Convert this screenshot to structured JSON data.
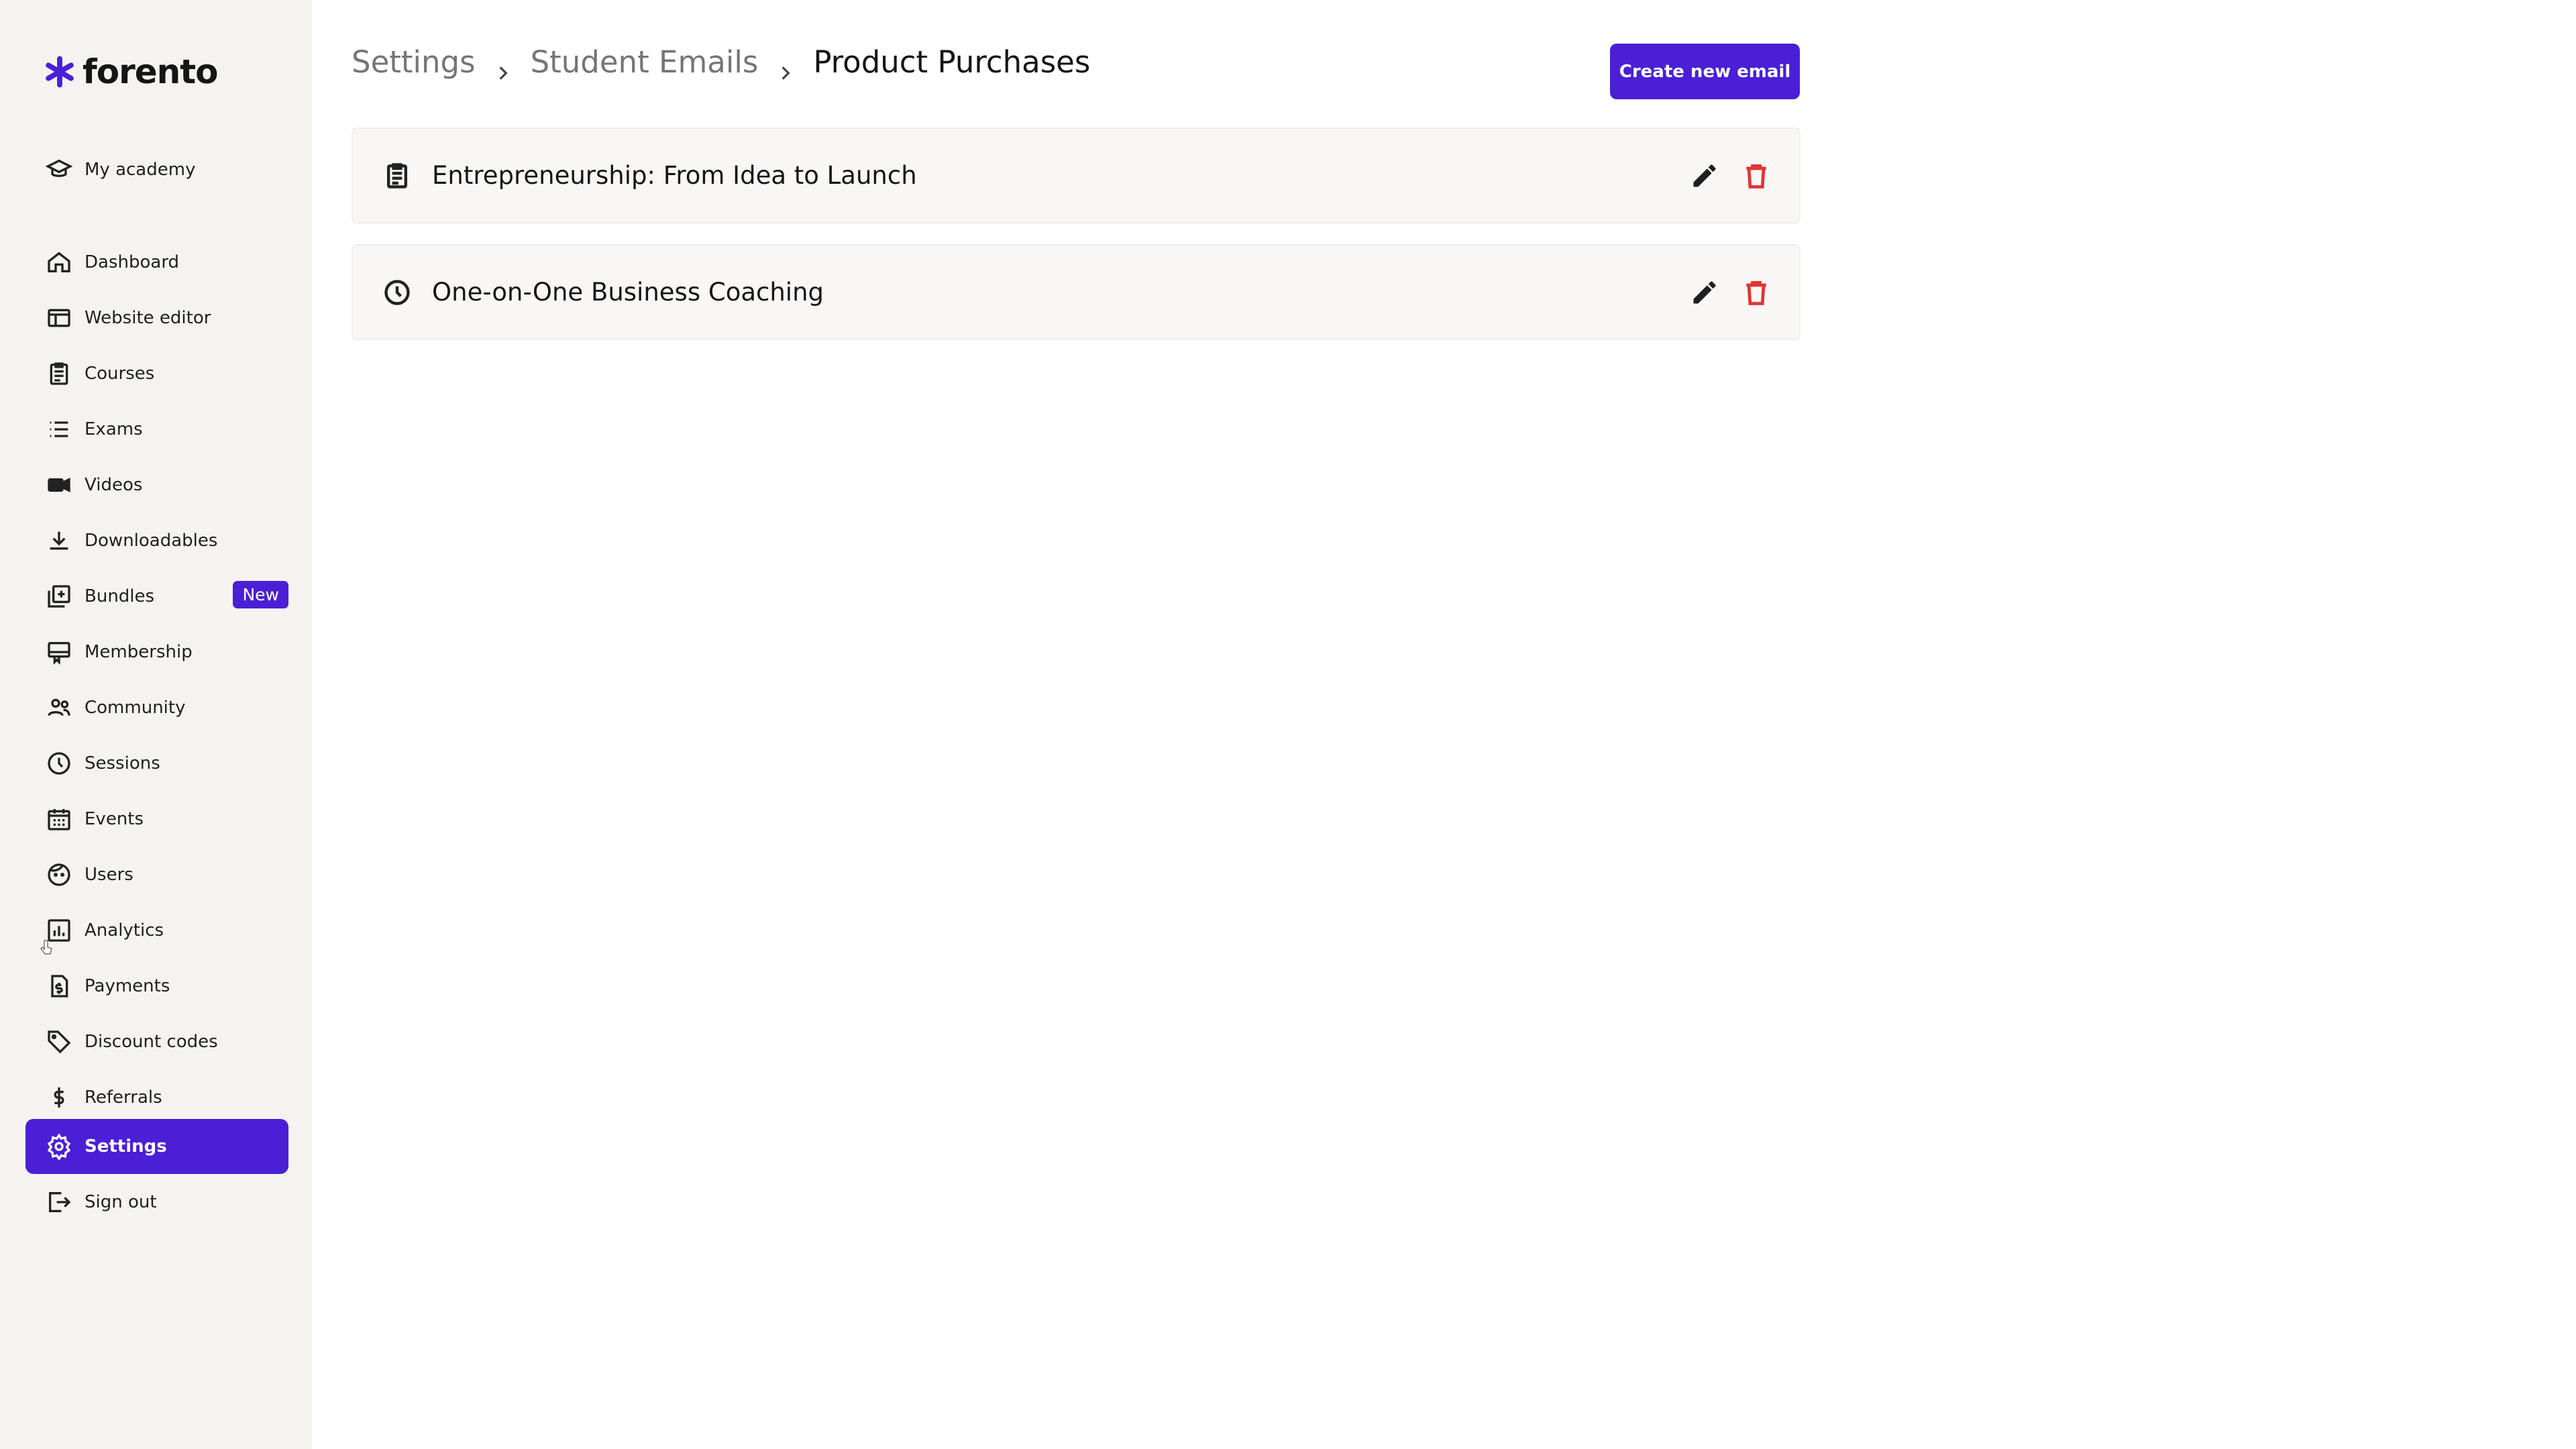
{
  "app": {
    "logo_text": "forento",
    "brand_color": "#4a1fd6"
  },
  "sidebar": {
    "top_item": {
      "label": "My academy",
      "icon": "academy-cap-icon"
    },
    "items": [
      {
        "label": "Dashboard",
        "icon": "home-icon"
      },
      {
        "label": "Website editor",
        "icon": "browser-window-icon"
      },
      {
        "label": "Courses",
        "icon": "clipboard-icon"
      },
      {
        "label": "Exams",
        "icon": "list-icon"
      },
      {
        "label": "Videos",
        "icon": "video-camera-icon"
      },
      {
        "label": "Downloadables",
        "icon": "download-icon"
      },
      {
        "label": "Bundles",
        "icon": "bundle-add-icon",
        "badge": "New"
      },
      {
        "label": "Membership",
        "icon": "membership-card-icon"
      },
      {
        "label": "Community",
        "icon": "people-icon"
      },
      {
        "label": "Sessions",
        "icon": "clock-icon"
      },
      {
        "label": "Events",
        "icon": "calendar-icon"
      },
      {
        "label": "Users",
        "icon": "face-icon"
      },
      {
        "label": "Analytics",
        "icon": "bar-chart-icon"
      },
      {
        "label": "Payments",
        "icon": "invoice-dollar-icon"
      },
      {
        "label": "Discount codes",
        "icon": "tag-icon"
      },
      {
        "label": "Referrals",
        "icon": "dollar-icon"
      },
      {
        "label": "Settings",
        "icon": "gear-icon",
        "active": true
      },
      {
        "label": "Sign out",
        "icon": "sign-out-icon"
      }
    ]
  },
  "breadcrumb": {
    "items": [
      "Settings",
      "Student Emails",
      "Product Purchases"
    ]
  },
  "actions": {
    "create_label": "Create new email"
  },
  "emails": [
    {
      "title": "Entrepreneurship: From Idea to Launch",
      "icon": "clipboard-icon"
    },
    {
      "title": "One-on-One Business Coaching",
      "icon": "clock-icon"
    }
  ],
  "colors": {
    "delete": "#e23333",
    "sidebar_bg": "#f4f3f0"
  }
}
